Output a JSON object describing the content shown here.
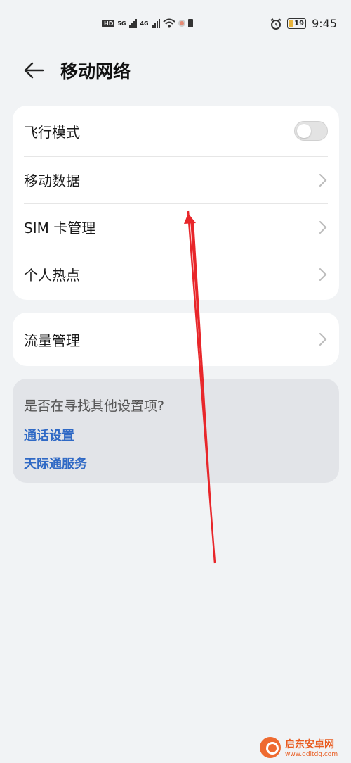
{
  "status_bar": {
    "hd": "HD",
    "net1": "5G",
    "net2": "4G",
    "battery": "19",
    "time": "9:45"
  },
  "header": {
    "title": "移动网络"
  },
  "settings": {
    "items": [
      {
        "label": "飞行模式",
        "toggle_on": false
      },
      {
        "label": "移动数据"
      },
      {
        "label": "SIM 卡管理"
      },
      {
        "label": "个人热点"
      }
    ],
    "traffic": {
      "label": "流量管理"
    }
  },
  "suggestions": {
    "title": "是否在寻找其他设置项?",
    "links": [
      "通话设置",
      "天际通服务"
    ]
  },
  "watermark": {
    "title": "启东安卓网",
    "url": "www.qdltdq.com"
  },
  "colors": {
    "background": "#f1f3f5",
    "link": "#2f69c5",
    "annotation_arrow": "#e8262a"
  },
  "icons": [
    "back-arrow-icon",
    "chevron-right-icon",
    "alarm-icon",
    "wifi-icon",
    "battery-icon"
  ]
}
